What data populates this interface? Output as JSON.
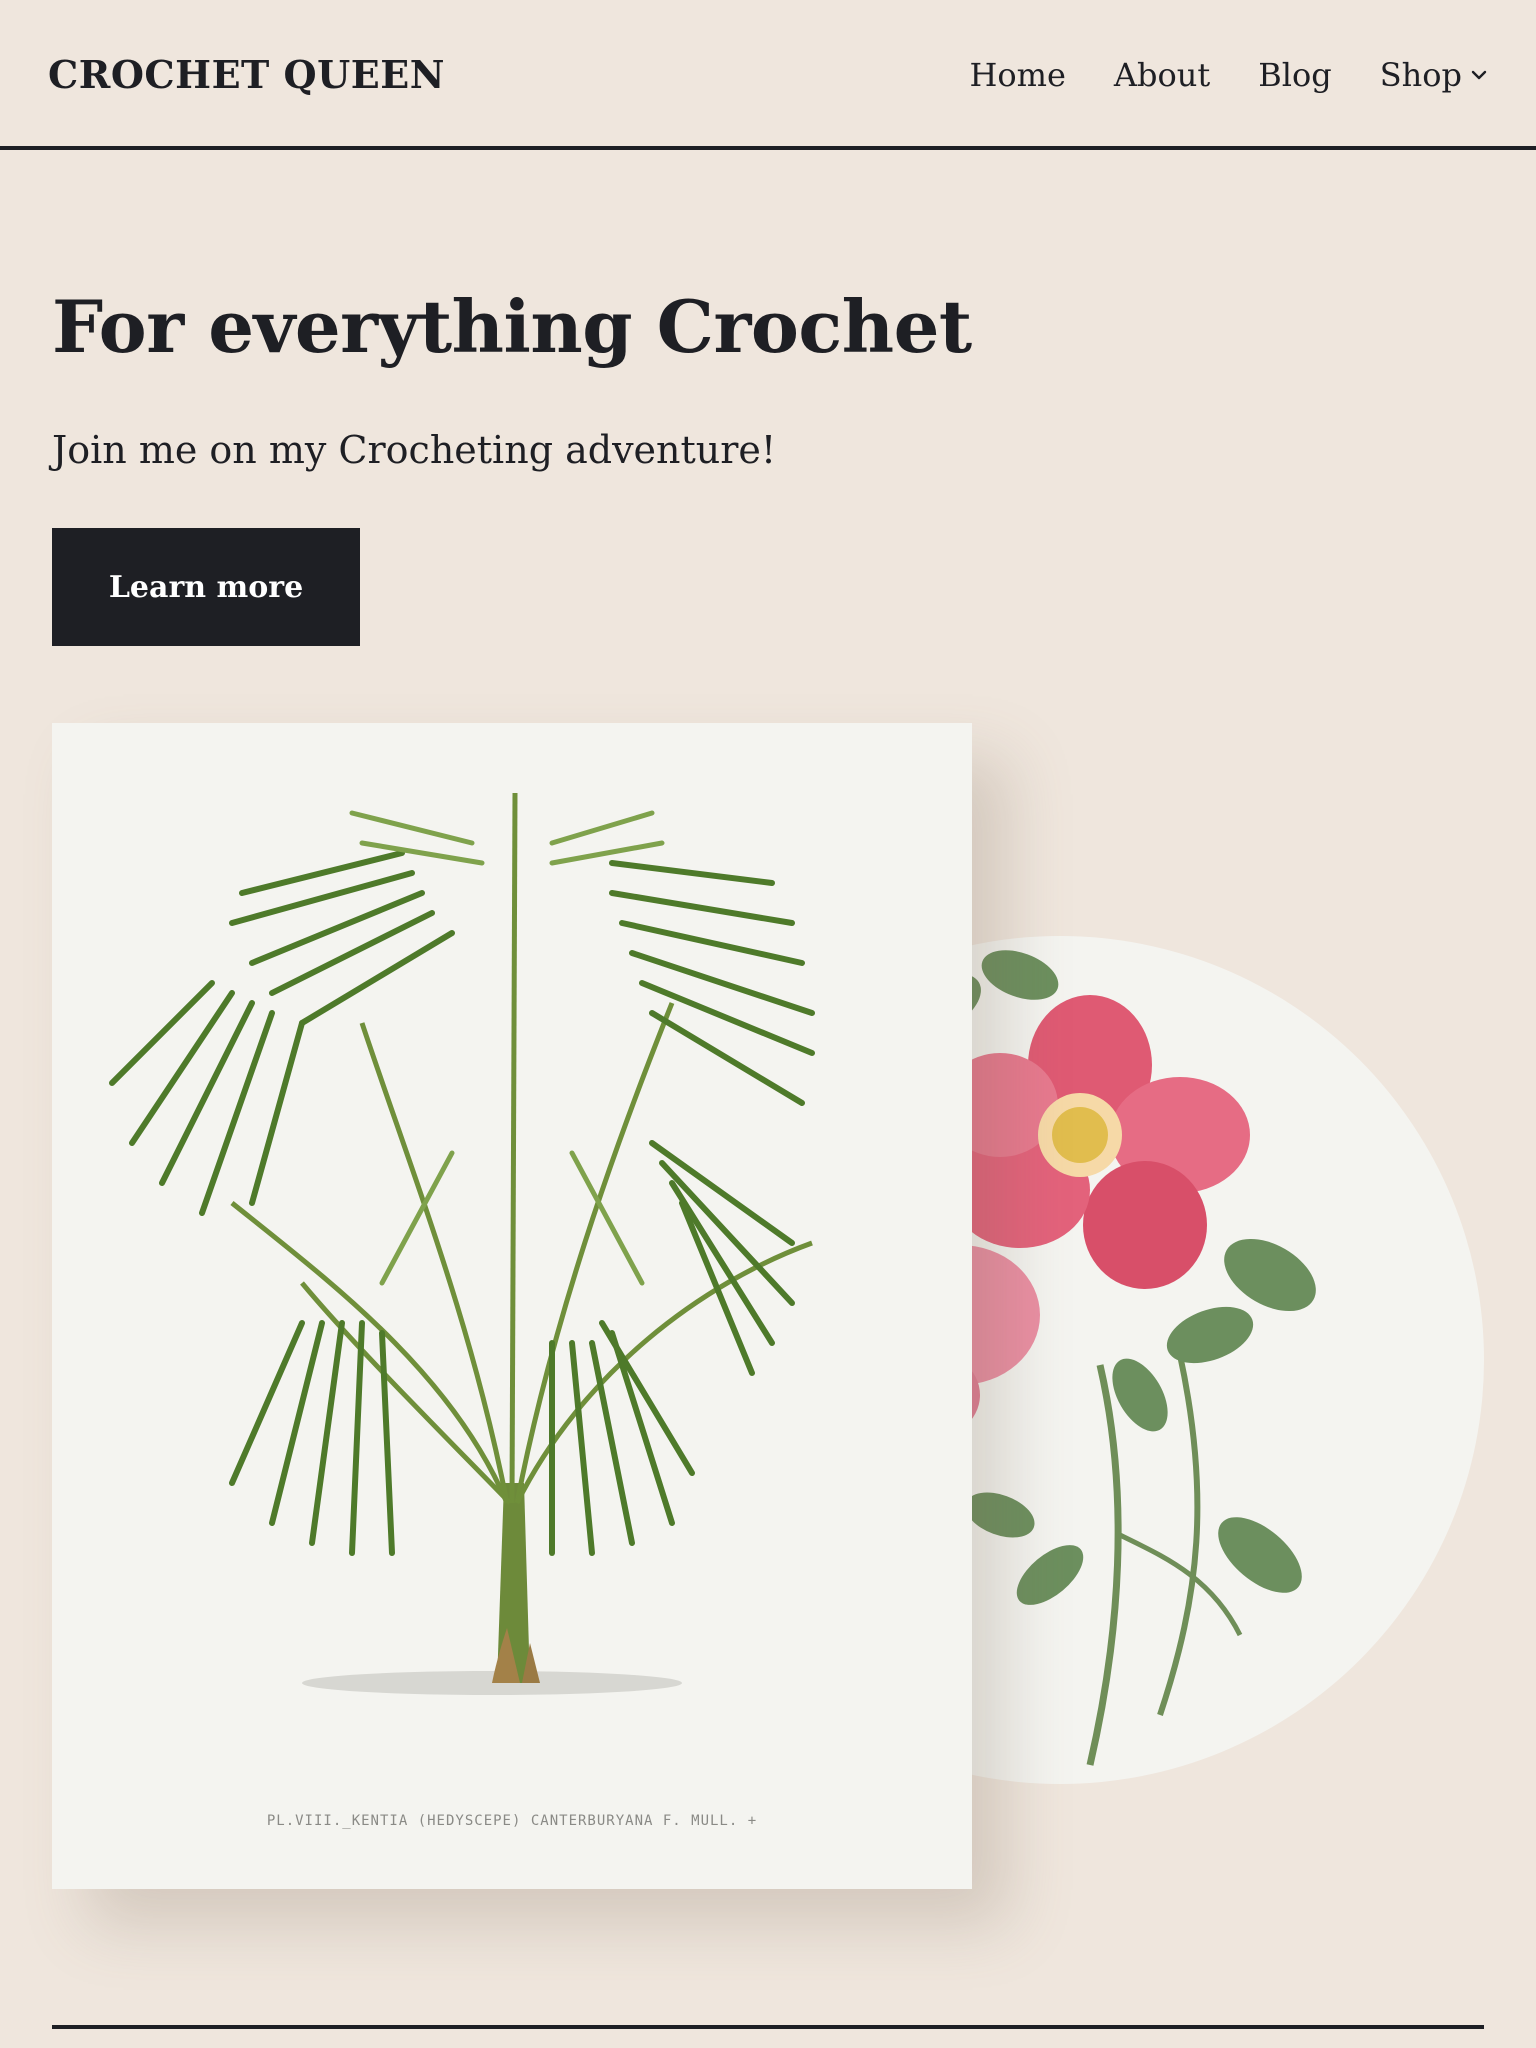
{
  "header": {
    "site_title": "CROCHET QUEEN",
    "nav": [
      {
        "label": "Home"
      },
      {
        "label": "About"
      },
      {
        "label": "Blog"
      },
      {
        "label": "Shop"
      }
    ]
  },
  "hero": {
    "heading": "For everything Crochet",
    "subheading": "Join me on my Crocheting adventure!",
    "cta_label": "Learn more"
  },
  "gallery": {
    "print_caption": "PL.VIII._KENTIA (HEDYSCEPE) CANTERBURYANA F. MULL. +"
  },
  "colors": {
    "background": "#efe6dd",
    "text": "#1e1f24",
    "button_bg": "#1e1f24",
    "button_text": "#ffffff",
    "card_bg": "#f4f4f0",
    "rose_pink": "#e0566f",
    "leaf_green": "#5d7f3c"
  },
  "icons": {
    "shop_dropdown": "chevron-down-icon"
  }
}
